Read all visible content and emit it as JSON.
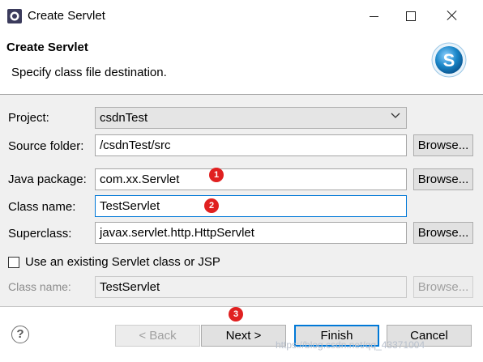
{
  "window": {
    "title": "Create Servlet",
    "icon": "eclipse-icon",
    "controls": [
      "minimize",
      "maximize",
      "close"
    ]
  },
  "header": {
    "title": "Create Servlet",
    "description": "Specify class file destination.",
    "logo": "servlet-s-logo",
    "logo_letter": "S",
    "accent": "#1a86c8"
  },
  "form": {
    "project": {
      "label": "Project:",
      "value": "csdnTest"
    },
    "source_folder": {
      "label": "Source folder:",
      "value": "/csdnTest/src",
      "button": "Browse..."
    },
    "java_package": {
      "label": "Java package:",
      "value": "com.xx.Servlet",
      "button": "Browse..."
    },
    "class_name": {
      "label": "Class name:",
      "value": "TestServlet"
    },
    "superclass": {
      "label": "Superclass:",
      "value": "javax.servlet.http.HttpServlet",
      "button": "Browse..."
    },
    "use_existing": {
      "label": "Use an existing Servlet class or JSP",
      "checked": false
    },
    "existing_class": {
      "label": "Class name:",
      "value": "TestServlet",
      "button": "Browse..."
    }
  },
  "footer": {
    "help_icon": "help-icon",
    "help_glyph": "?",
    "back": "< Back",
    "next": "Next >",
    "finish": "Finish",
    "cancel": "Cancel"
  },
  "annotations": [
    "1",
    "2",
    "3"
  ],
  "annotation_color": "#e02020",
  "watermark": "https://blog.csdn.net/qq_43371004"
}
